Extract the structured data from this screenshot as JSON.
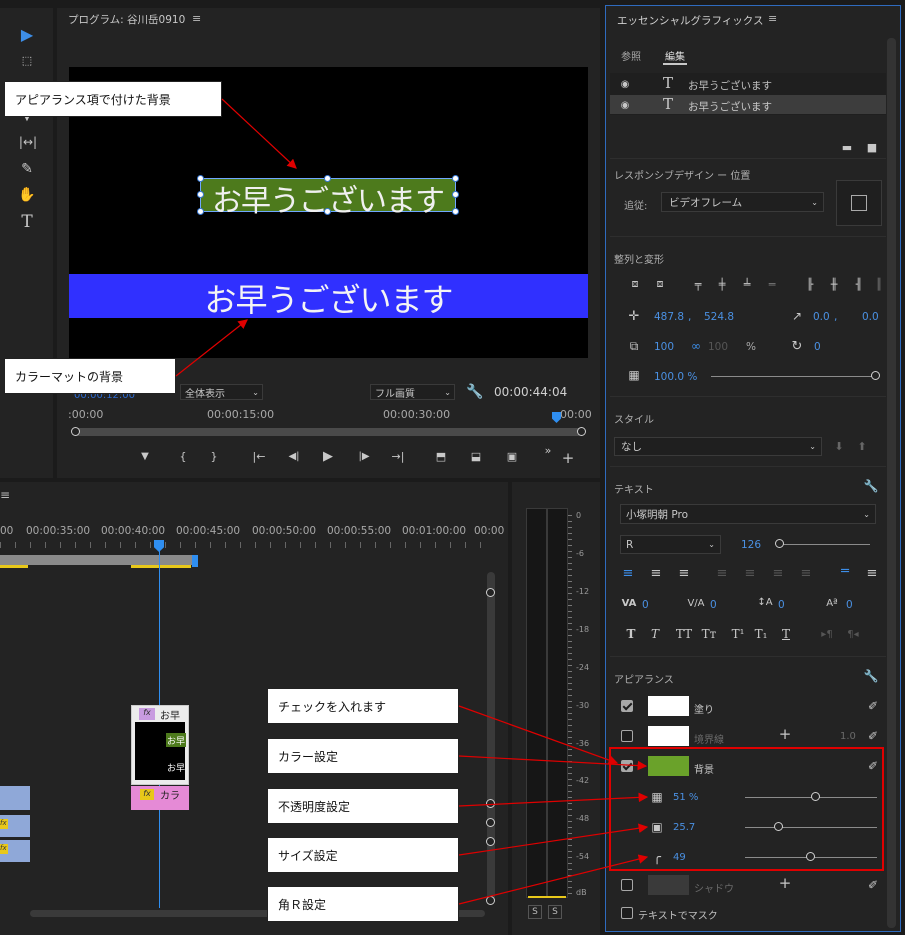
{
  "program": {
    "title": "プログラム: 谷川岳0910",
    "menu_icon": "hamburger-icon",
    "fit": "全体表示",
    "quality": "フル画質",
    "timecode": "00:00:44:04",
    "ruler": [
      ":00:00",
      "00:00:15:00",
      "00:00:30:00",
      "00:00"
    ],
    "caption_top": "お早うございます",
    "caption_bottom": "お早うございます",
    "caption_top_bg": "#4d7a1c",
    "caption_bottom_bg": "#3030ff"
  },
  "timeline": {
    "ruler": [
      "00",
      "00:00:35:00",
      "00:00:40:00",
      "00:00:45:00",
      "00:00:50:00",
      "00:00:55:00",
      "00:01:00:00",
      "00:00"
    ],
    "clip_title": "お早",
    "clip_inner1": "お早",
    "clip_inner2": "お早",
    "clip_color": "カラ",
    "fx": "fx"
  },
  "meter": {
    "ticks": [
      "0",
      "-6",
      "-12",
      "-18",
      "-24",
      "-30",
      "-36",
      "-42",
      "-48",
      "-54",
      "dB"
    ],
    "solo": [
      "S",
      "S"
    ]
  },
  "eg": {
    "title": "エッセンシャルグラフィックス",
    "tab_browse": "参照",
    "tab_edit": "編集",
    "layers": [
      "お早うございます",
      "お早うございます"
    ],
    "responsive_title": "レスポンシブデザイン ー 位置",
    "follow_label": "追従:",
    "follow_value": "ビデオフレーム",
    "align_title": "整列と変形",
    "pos_x": "487.8",
    "pos_y": "524.8",
    "anchor_x": "0.0",
    "anchor_y": "0.0",
    "scale": "100",
    "scale2": "100",
    "pct": "%",
    "rotation": "0",
    "opacity": "100.0 %",
    "style_title": "スタイル",
    "style_value": "なし",
    "text_title": "テキスト",
    "font": "小塚明朝 Pro",
    "font_style": "R",
    "font_size": "126",
    "tracking": "0",
    "kerning": "0",
    "leading": "0",
    "baseline": "0",
    "appearance_title": "アピアランス",
    "fill_label": "塗り",
    "stroke_label": "境界線",
    "stroke_value": "1.0",
    "bg_label": "背景",
    "bg_opacity": "51 %",
    "bg_size": "25.7",
    "bg_radius": "49",
    "shadow_label": "シャドウ",
    "mask_label": "テキストでマスク",
    "bg_color": "#6aa22a"
  },
  "callouts": {
    "appearance_bg": "アピアランス項で付けた背景",
    "colormatte_bg": "カラーマットの背景",
    "check": "チェックを入れます",
    "color": "カラー設定",
    "opacity": "不透明度設定",
    "size": "サイズ設定",
    "radius": "角Ｒ設定"
  }
}
